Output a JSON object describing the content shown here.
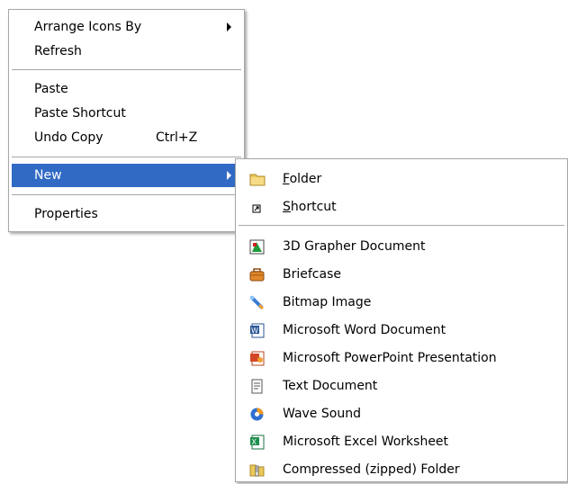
{
  "context_menu": {
    "arrange_icons_by": "Arrange Icons By",
    "refresh": "Refresh",
    "paste": "Paste",
    "paste_shortcut": "Paste Shortcut",
    "undo_copy": "Undo Copy",
    "undo_copy_shortcut": "Ctrl+Z",
    "new": "New",
    "properties": "Properties"
  },
  "new_submenu": {
    "folder": {
      "accel": "F",
      "rest": "older"
    },
    "shortcut": {
      "accel": "S",
      "rest": "hortcut"
    },
    "items": [
      {
        "label": "3D Grapher Document",
        "icon": "3d-grapher-icon"
      },
      {
        "label": "Briefcase",
        "icon": "briefcase-icon"
      },
      {
        "label": "Bitmap Image",
        "icon": "bitmap-image-icon"
      },
      {
        "label": "Microsoft Word Document",
        "icon": "word-document-icon"
      },
      {
        "label": "Microsoft PowerPoint Presentation",
        "icon": "powerpoint-icon"
      },
      {
        "label": "Text Document",
        "icon": "text-document-icon"
      },
      {
        "label": "Wave Sound",
        "icon": "wave-sound-icon"
      },
      {
        "label": "Microsoft Excel Worksheet",
        "icon": "excel-worksheet-icon"
      },
      {
        "label": "Compressed (zipped) Folder",
        "icon": "zipped-folder-icon"
      }
    ]
  },
  "colors": {
    "highlight": "#316ac5",
    "separator": "#a7a6aa"
  }
}
